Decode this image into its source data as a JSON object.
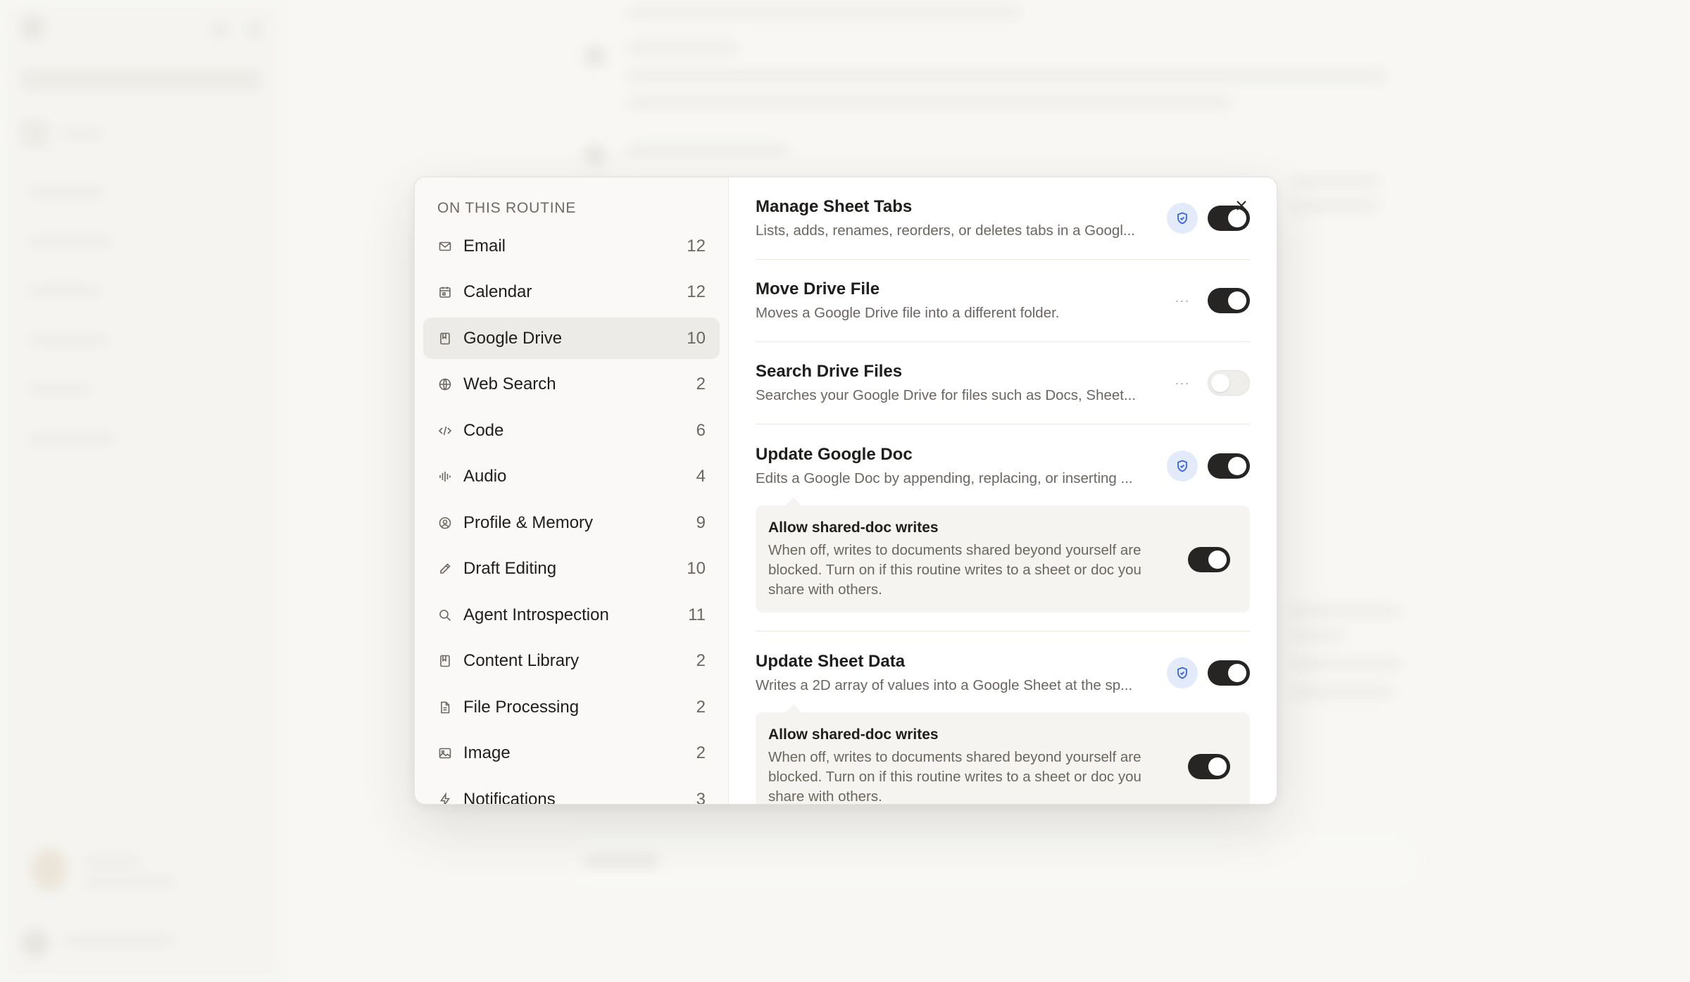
{
  "nav": {
    "heading": "ON THIS ROUTINE",
    "items": [
      {
        "label": "Email",
        "count": "12",
        "icon": "mail-icon"
      },
      {
        "label": "Calendar",
        "count": "12",
        "icon": "calendar-icon"
      },
      {
        "label": "Google Drive",
        "count": "10",
        "icon": "drive-icon",
        "active": true
      },
      {
        "label": "Web Search",
        "count": "2",
        "icon": "globe-icon"
      },
      {
        "label": "Code",
        "count": "6",
        "icon": "code-icon"
      },
      {
        "label": "Audio",
        "count": "4",
        "icon": "audio-waveform-icon"
      },
      {
        "label": "Profile & Memory",
        "count": "9",
        "icon": "profile-icon"
      },
      {
        "label": "Draft Editing",
        "count": "10",
        "icon": "pencil-icon"
      },
      {
        "label": "Agent Introspection",
        "count": "11",
        "icon": "search-icon"
      },
      {
        "label": "Content Library",
        "count": "2",
        "icon": "library-icon"
      },
      {
        "label": "File Processing",
        "count": "2",
        "icon": "file-icon"
      },
      {
        "label": "Image",
        "count": "2",
        "icon": "image-icon"
      },
      {
        "label": "Notifications",
        "count": "3",
        "icon": "bolt-icon"
      }
    ]
  },
  "tools": [
    {
      "title": "Manage Sheet Tabs",
      "desc": "Lists, adds, renames, reorders, or deletes tabs in a Googl...",
      "badge": "shield",
      "enabled": true
    },
    {
      "title": "Move Drive File",
      "desc": "Moves a Google Drive file into a different folder.",
      "badge": "more",
      "enabled": true
    },
    {
      "title": "Search Drive Files",
      "desc": "Searches your Google Drive for files such as Docs, Sheet...",
      "badge": "more",
      "enabled": false
    },
    {
      "title": "Update Google Doc",
      "desc": "Edits a Google Doc by appending, replacing, or inserting ...",
      "badge": "shield",
      "enabled": true,
      "sub": {
        "title": "Allow shared-doc writes",
        "desc": "When off, writes to documents shared beyond yourself are blocked. Turn on if this routine writes to a sheet or doc you share with others.",
        "enabled": true
      }
    },
    {
      "title": "Update Sheet Data",
      "desc": "Writes a 2D array of values into a Google Sheet at the sp...",
      "badge": "shield",
      "enabled": true,
      "sub": {
        "title": "Allow shared-doc writes",
        "desc": "When off, writes to documents shared beyond yourself are blocked. Turn on if this routine writes to a sheet or doc you share with others.",
        "enabled": true
      }
    }
  ],
  "more_glyph": "···",
  "colors": {
    "toggle_on": "#262524",
    "shield_bg": "#e3ebfb",
    "shield_stroke": "#3a63d8",
    "active_nav": "#ecebe7"
  }
}
